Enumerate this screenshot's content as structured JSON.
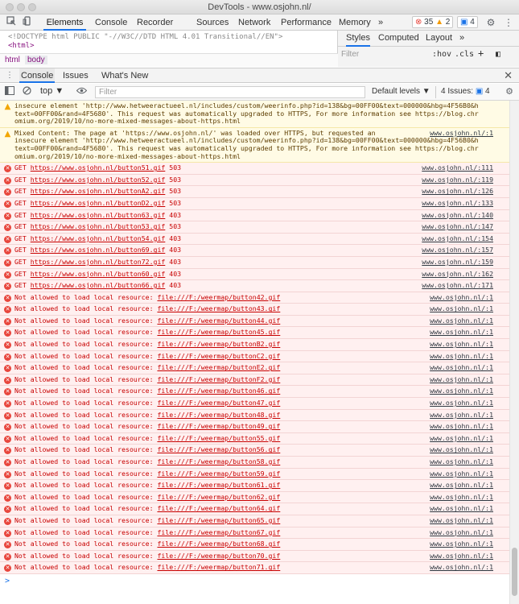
{
  "window": {
    "title": "DevTools - www.osjohn.nl/"
  },
  "toolbar": {
    "tabs": [
      "Elements",
      "Console",
      "Recorder",
      "Sources",
      "Network",
      "Performance",
      "Memory"
    ],
    "more": "»",
    "errors": "35",
    "warnings": "2",
    "info": "4"
  },
  "elements": {
    "lines": [
      "<!DOCTYPE html PUBLIC \"-//W3C//DTD HTML 4.01 Transitional//EN\">",
      "<html>"
    ],
    "crumbs": [
      "html",
      "body"
    ]
  },
  "styles": {
    "tabs": [
      "Styles",
      "Computed",
      "Layout"
    ],
    "more": "»",
    "filter_placeholder": "Filter",
    "hov": ":hov",
    "cls": ".cls"
  },
  "drawer": {
    "tabs": [
      "Console",
      "Issues",
      "What's New"
    ],
    "close": "✕"
  },
  "console_toolbar": {
    "context": "top ▼",
    "filter_placeholder": "Filter",
    "levels": "Default levels ▼",
    "issues": "4 Issues:",
    "issues_count": "4"
  },
  "warnings": [
    {
      "lines": [
        "insecure element 'http://www.hetweeractueel.nl/includes/custom/weerinfo.php?id=138&bg=00FF00&text=000000&hbg=4F56B0&h",
        "text=00FF00&rand=4F5680'. This request was automatically upgraded to HTTPS, For more information see https://blog.chr",
        "omium.org/2019/10/no-more-mixed-messages-about-https.html"
      ],
      "source": ""
    },
    {
      "lines": [
        "Mixed Content: The page at 'https://www.osjohn.nl/' was loaded over HTTPS, but requested an",
        "insecure element 'http://www.hetweeractueel.nl/includes/custom/weerinfo.php?id=138&bg=00FF00&text=000000&hbg=4F56B0&h",
        "text=00FF00&rand=4F5680'. This request was automatically upgraded to HTTPS, For more information see https://blog.chr",
        "omium.org/2019/10/no-more-mixed-messages-about-https.html"
      ],
      "source": "www.osjohn.nl/:1"
    }
  ],
  "get_errors": [
    {
      "url": "https://www.osjohn.nl/button51.gif",
      "status": "503",
      "source": "www.osjohn.nl/:111"
    },
    {
      "url": "https://www.osjohn.nl/button52.gif",
      "status": "503",
      "source": "www.osjohn.nl/:119"
    },
    {
      "url": "https://www.osjohn.nl/buttonA2.gif",
      "status": "503",
      "source": "www.osjohn.nl/:126"
    },
    {
      "url": "https://www.osjohn.nl/buttonD2.gif",
      "status": "503",
      "source": "www.osjohn.nl/:133"
    },
    {
      "url": "https://www.osjohn.nl/button63.gif",
      "status": "403",
      "source": "www.osjohn.nl/:140"
    },
    {
      "url": "https://www.osjohn.nl/button53.gif",
      "status": "503",
      "source": "www.osjohn.nl/:147"
    },
    {
      "url": "https://www.osjohn.nl/button54.gif",
      "status": "403",
      "source": "www.osjohn.nl/:154"
    },
    {
      "url": "https://www.osjohn.nl/button69.gif",
      "status": "403",
      "source": "www.osjohn.nl/:157"
    },
    {
      "url": "https://www.osjohn.nl/button72.gif",
      "status": "403",
      "source": "www.osjohn.nl/:159"
    },
    {
      "url": "https://www.osjohn.nl/button60.gif",
      "status": "403",
      "source": "www.osjohn.nl/:162"
    },
    {
      "url": "https://www.osjohn.nl/button66.gif",
      "status": "403",
      "source": "www.osjohn.nl/:171"
    }
  ],
  "local_errors": {
    "text": "Not allowed to load local resource:",
    "source": "www.osjohn.nl/:1",
    "files": [
      "file:///F:/weermap/button42.gif",
      "file:///F:/weermap/button43.gif",
      "file:///F:/weermap/button44.gif",
      "file:///F:/weermap/button45.gif",
      "file:///F:/weermap/buttonB2.gif",
      "file:///F:/weermap/buttonC2.gif",
      "file:///F:/weermap/buttonE2.gif",
      "file:///F:/weermap/buttonF2.gif",
      "file:///F:/weermap/button46.gif",
      "file:///F:/weermap/button47.gif",
      "file:///F:/weermap/button48.gif",
      "file:///F:/weermap/button49.gif",
      "file:///F:/weermap/button55.gif",
      "file:///F:/weermap/button56.gif",
      "file:///F:/weermap/button58.gif",
      "file:///F:/weermap/button59.gif",
      "file:///F:/weermap/button61.gif",
      "file:///F:/weermap/button62.gif",
      "file:///F:/weermap/button64.gif",
      "file:///F:/weermap/button65.gif",
      "file:///F:/weermap/button67.gif",
      "file:///F:/weermap/button68.gif",
      "file:///F:/weermap/button70.gif",
      "file:///F:/weermap/button71.gif"
    ]
  },
  "prompt": ">"
}
